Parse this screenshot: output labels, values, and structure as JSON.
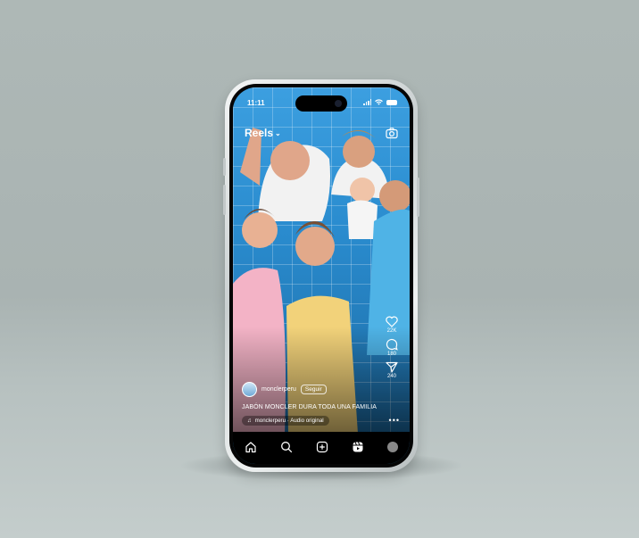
{
  "status_bar": {
    "time": "11:11"
  },
  "header": {
    "title": "Reels",
    "dropdown_icon": "chevron-down-icon",
    "camera_icon": "camera-icon"
  },
  "actions": {
    "like": {
      "icon": "heart-icon",
      "count": "22K"
    },
    "comment": {
      "icon": "comment-icon",
      "count": "180"
    },
    "share": {
      "icon": "send-icon",
      "count": "240"
    },
    "more": {
      "icon": "more-icon",
      "label": "•••"
    }
  },
  "post": {
    "username": "monclerperu",
    "follow_label": "Seguir",
    "caption": "JABÓN MONCLER DURA TODA UNA FAMILIA",
    "audio": "monclerperu · Audio original"
  },
  "nav": {
    "items": [
      "home-icon",
      "search-icon",
      "create-icon",
      "reels-icon",
      "profile-avatar"
    ]
  },
  "colors": {
    "accent_bg": "#2a8ccf",
    "navbar": "#000000"
  }
}
